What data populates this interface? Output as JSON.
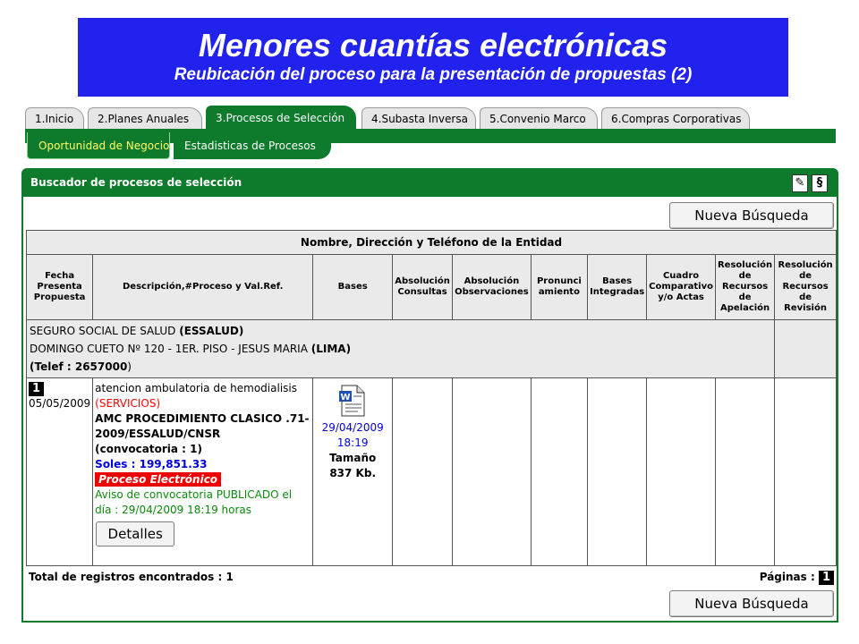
{
  "banner": {
    "title": "Menores cuantías electrónicas",
    "subtitle": "Reubicación del proceso para la presentación de propuestas (2)"
  },
  "tabs": [
    {
      "label": "1.Inicio"
    },
    {
      "label": "2.Planes Anuales"
    },
    {
      "label": "3.Procesos de Selección"
    },
    {
      "label": "4.Subasta Inversa"
    },
    {
      "label": "5.Convenio Marco"
    },
    {
      "label": "6.Compras Corporativas"
    }
  ],
  "subtabs": [
    {
      "label": "Oportunidad de Negocio"
    },
    {
      "label": "Estadisticas de Procesos"
    }
  ],
  "panel": {
    "title": "Buscador de procesos de selección",
    "new_search_label": "Nueva Búsqueda"
  },
  "table": {
    "caption": "Nombre, Dirección y Teléfono de la Entidad",
    "headers": [
      "Fecha Presenta Propuesta",
      "Descripción,#Proceso y Val.Ref.",
      "Bases",
      "Absolución Consultas",
      "Absolución Observaciones",
      "Pronunci amiento",
      "Bases Integradas",
      "Cuadro Comparativo y/o Actas",
      "Resolución de Recursos de Apelación",
      "Resolución de Recursos de Revisión"
    ],
    "entity": {
      "name": "SEGURO SOCIAL DE SALUD",
      "name_bold": "(ESSALUD)",
      "address": "DOMINGO CUETO Nº 120 - 1ER. PISO - JESUS MARIA",
      "address_bold": "(LIMA)",
      "phone_label": "(Telef : ",
      "phone_value": "2657000",
      "phone_close": ")"
    },
    "row": {
      "number": "1",
      "date": "05/05/2009",
      "description": "atencion ambulatoria de hemodialisis",
      "category": "(SERVICIOS)",
      "process": "AMC PROCEDIMIENTO CLASICO .71-2009/ESSALUD/CNSR",
      "convocatoria": "(convocatoria : 1)",
      "amount": "Soles : 199,851.33",
      "badge": "Proceso Electrónico",
      "notice": "Aviso de convocatoria PUBLICADO el día : 29/04/2009 18:19 horas",
      "details_label": "Detalles",
      "bases_date": "29/04/2009",
      "bases_time": "18:19",
      "size_label": "Tamaño",
      "size_value": "837 Kb."
    }
  },
  "footer": {
    "total": "Total de registros encontrados : 1",
    "pages_label": "Páginas :",
    "pages_value": "1"
  }
}
